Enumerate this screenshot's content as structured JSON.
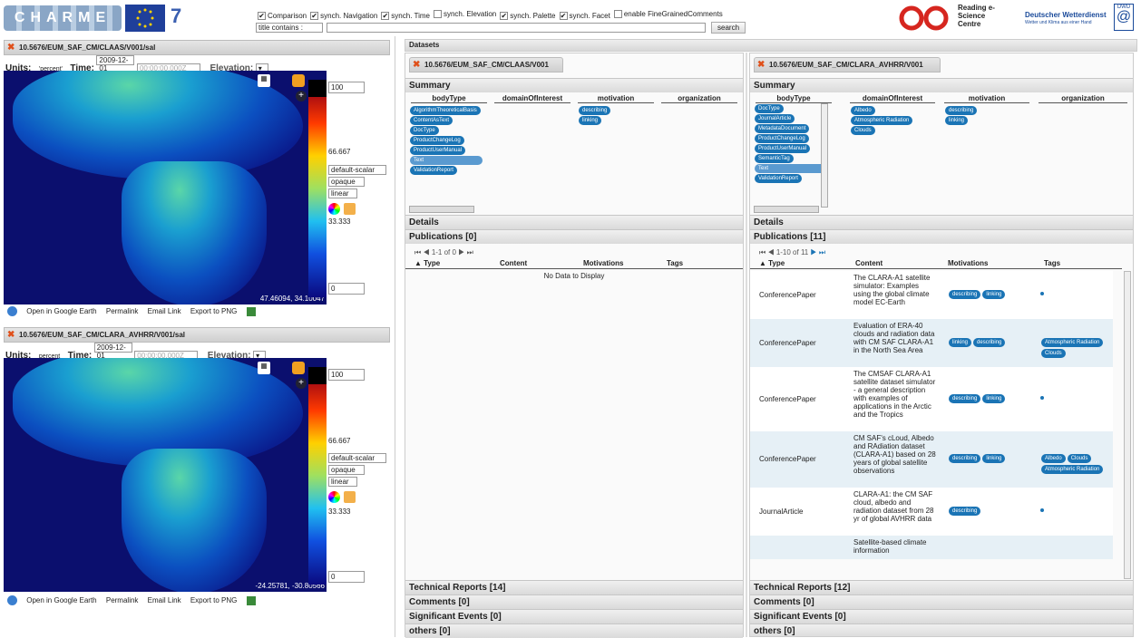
{
  "toolbar": {
    "checks": [
      {
        "label": "Comparison",
        "checked": true
      },
      {
        "label": "synch. Navigation",
        "checked": true
      },
      {
        "label": "synch. Time",
        "checked": true
      },
      {
        "label": "synch. Elevation",
        "checked": false
      },
      {
        "label": "synch. Palette",
        "checked": true
      },
      {
        "label": "synch. Facet",
        "checked": true
      },
      {
        "label": "enable FineGrainedComments",
        "checked": false
      }
    ],
    "filter_select": "title contains :",
    "search_label": "search",
    "reading_logo": "Reading e-Science Centre",
    "dwd_logo": "Deutscher Wetterdienst",
    "dwd_tagline": "Wetter und Klima aus einer Hand",
    "dwd_badge": "DWD"
  },
  "map1": {
    "title": "10.5676/EUM_SAF_CM/CLAAS/V001/sal",
    "units_label": "Units:",
    "units_value": "'percent'",
    "time_label": "Time:",
    "date": "2009-12-01",
    "time": "00:00:00.000Z",
    "elevation_label": "Elevation:",
    "ticks": [
      "100",
      "66.667",
      "33.333",
      "0"
    ],
    "style_select": "default-scalar",
    "opacity_select": "opaque",
    "scale_select": "linear",
    "coords": "47.46094, 34.10047",
    "links": [
      "Open in Google Earth",
      "Permalink",
      "Email Link",
      "Export to PNG"
    ]
  },
  "map2": {
    "title": "10.5676/EUM_SAF_CM/CLARA_AVHRR/V001/sal",
    "units_label": "Units:",
    "units_value": "percent",
    "time_label": "Time:",
    "date": "2009-12-01",
    "time": "00:00:00.000Z",
    "elevation_label": "Elevation:",
    "ticks": [
      "100",
      "66.667",
      "33.333",
      "0"
    ],
    "style_select": "default-scalar",
    "opacity_select": "opaque",
    "scale_select": "linear",
    "coords": "-24.25781, -30.80566",
    "links": [
      "Open in Google Earth",
      "Permalink",
      "Email Link",
      "Export to PNG"
    ]
  },
  "datasets_tab": "Datasets",
  "col_headers": [
    "bodyType",
    "domainOfInterest",
    "motivation",
    "organization"
  ],
  "pub_headers": [
    "Type",
    "Content",
    "Motivations",
    "Tags"
  ],
  "ds1": {
    "title": "10.5676/EUM_SAF_CM/CLAAS/V001",
    "summary": "Summary",
    "bodytypes": [
      "AlgorithmTheoreticalBasis",
      "ContentAsText",
      "DocType",
      "ProductChangeLog",
      "ProductUserManual",
      "Text",
      "ValidationReport"
    ],
    "motivations": [
      "describing",
      "linking"
    ],
    "details": "Details",
    "publications": "Publications [0]",
    "pager": "1-1 of 0",
    "nodata": "No Data to Display",
    "tech": "Technical Reports [14]",
    "comments": "Comments [0]",
    "events": "Significant Events [0]",
    "others": "others [0]"
  },
  "ds2": {
    "title": "10.5676/EUM_SAF_CM/CLARA_AVHRR/V001",
    "summary": "Summary",
    "bodytypes": [
      "DocType",
      "JournalArticle",
      "MetadataDocument",
      "ProductChangeLog",
      "ProductUserManual",
      "SemanticTag",
      "Text",
      "ValidationReport"
    ],
    "domains": [
      "Albedo",
      "Atmospheric Radiation",
      "Clouds"
    ],
    "motivations": [
      "describing",
      "linking"
    ],
    "details": "Details",
    "publications": "Publications [11]",
    "pager": "1-10 of 11",
    "rows": [
      {
        "type": "ConferencePaper",
        "content": "The CLARA-A1 satellite simulator: Examples using the global climate model EC-Earth",
        "motivations": [
          "describing",
          "linking"
        ],
        "tags": []
      },
      {
        "type": "ConferencePaper",
        "content": "Evaluation of ERA-40 clouds and radiation data with CM SAF CLARA-A1 in the North Sea Area",
        "motivations": [
          "linking",
          "describing"
        ],
        "tags": [
          "Atmospheric Radiation",
          "Clouds"
        ]
      },
      {
        "type": "ConferencePaper",
        "content": "The CMSAF CLARA-A1 satellite dataset simulator - a general description with examples of applications in the Arctic and the Tropics",
        "motivations": [
          "describing",
          "linking"
        ],
        "tags": []
      },
      {
        "type": "ConferencePaper",
        "content": "CM SAF's cLoud, Albedo and RAdiation dataset (CLARA-A1) based on 28 years of global satellite observations",
        "motivations": [
          "describing",
          "linking"
        ],
        "tags": [
          "Albedo",
          "Clouds",
          "Atmospheric Radiation"
        ]
      },
      {
        "type": "JournalArticle",
        "content": "CLARA-A1: the CM SAF cloud, albedo and radiation dataset from 28 yr of global AVHRR data",
        "motivations": [
          "describing"
        ],
        "tags": []
      },
      {
        "type": "",
        "content": "Satellite-based climate information",
        "motivations": [],
        "tags": []
      }
    ],
    "tech": "Technical Reports [12]",
    "comments": "Comments [0]",
    "events": "Significant Events [0]",
    "others": "others [0]"
  }
}
